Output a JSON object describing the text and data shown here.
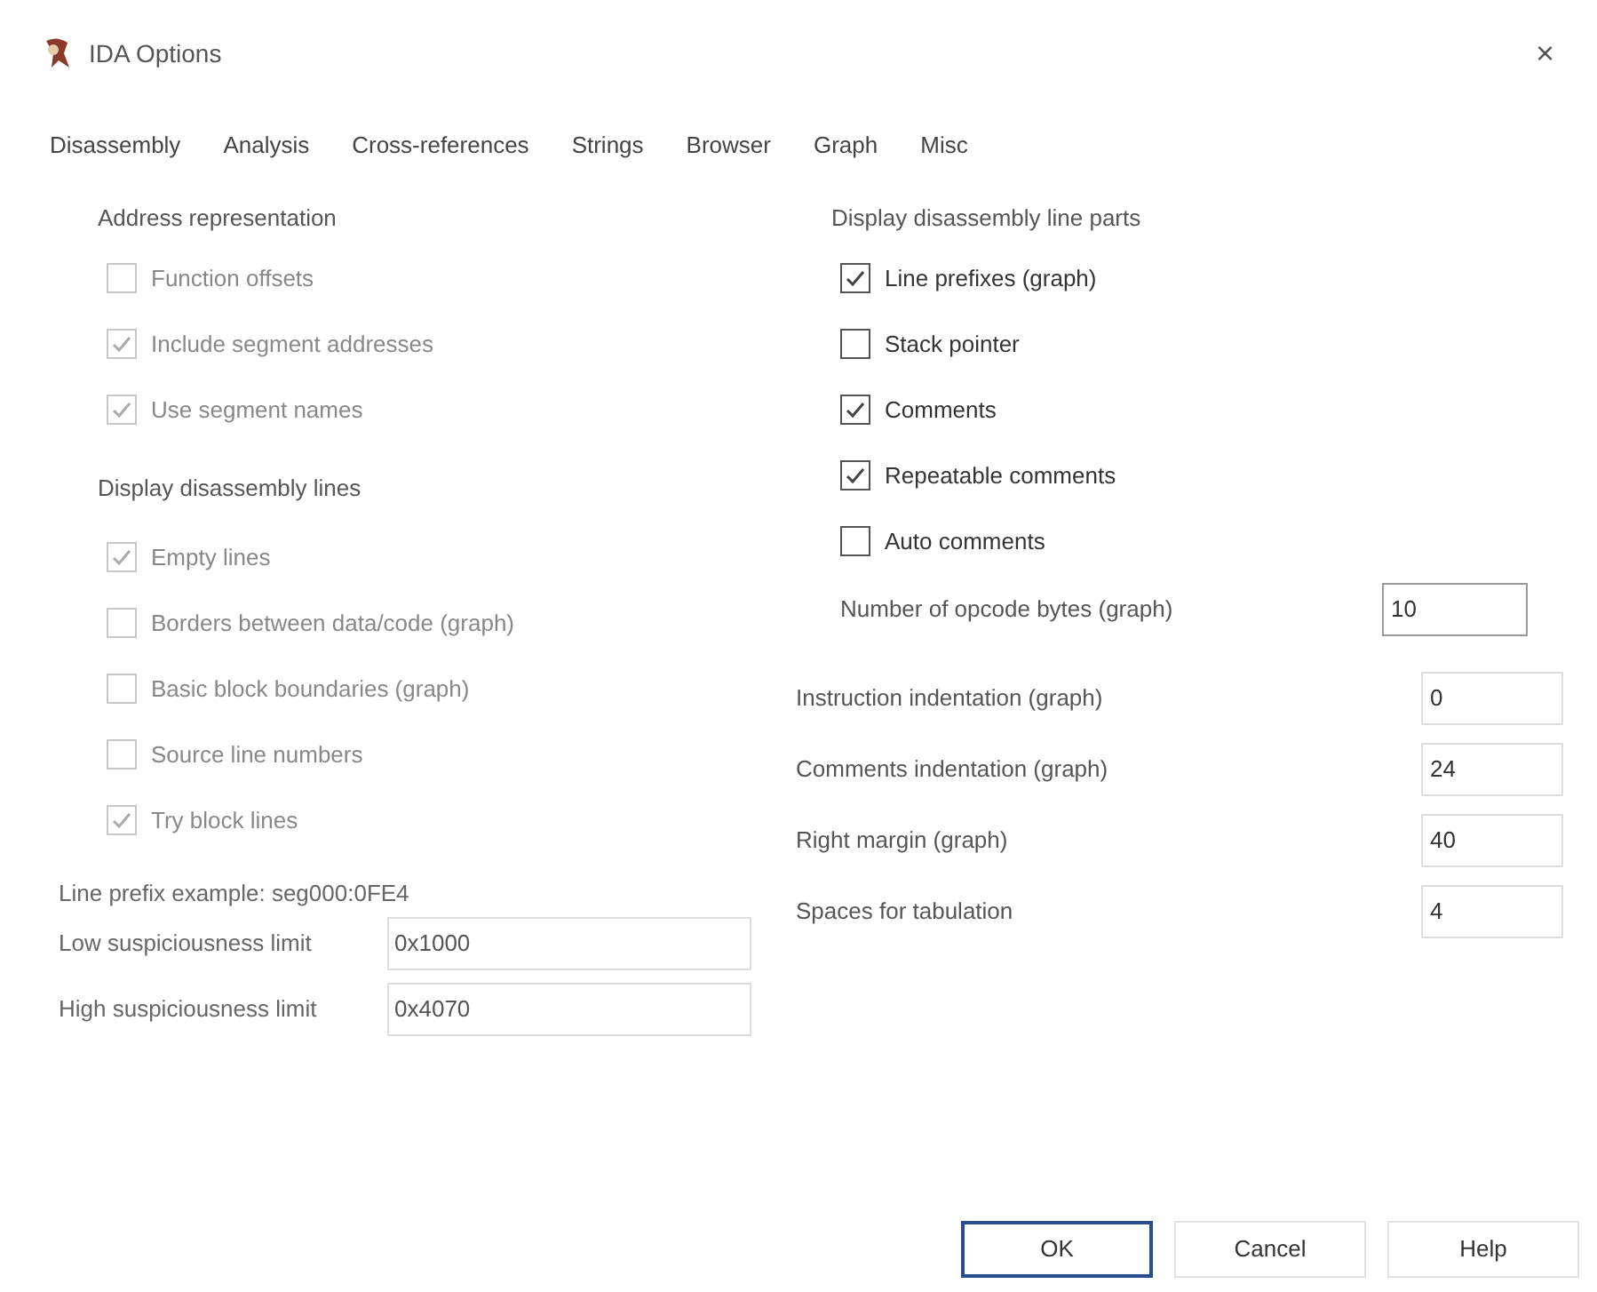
{
  "window": {
    "title": "IDA Options",
    "close": "×"
  },
  "tabs": [
    "Disassembly",
    "Analysis",
    "Cross-references",
    "Strings",
    "Browser",
    "Graph",
    "Misc"
  ],
  "left": {
    "address_group": {
      "title": "Address representation",
      "options": [
        {
          "label": "Function offsets",
          "checked": false,
          "disabled": true
        },
        {
          "label": "Include segment addresses",
          "checked": true,
          "disabled": true
        },
        {
          "label": "Use segment names",
          "checked": true,
          "disabled": true
        }
      ]
    },
    "lines_group": {
      "title": "Display disassembly lines",
      "options": [
        {
          "label": "Empty lines",
          "checked": true,
          "disabled": true
        },
        {
          "label": "Borders between data/code (graph)",
          "checked": false,
          "disabled": true
        },
        {
          "label": "Basic block boundaries (graph)",
          "checked": false,
          "disabled": true
        },
        {
          "label": "Source line numbers",
          "checked": false,
          "disabled": true
        },
        {
          "label": "Try block lines",
          "checked": true,
          "disabled": true
        }
      ]
    },
    "line_prefix_example": "Line prefix example: seg000:0FE4",
    "fields": [
      {
        "label": "Low suspiciousness limit",
        "value": "0x1000"
      },
      {
        "label": "High suspiciousness limit",
        "value": "0x4070"
      }
    ]
  },
  "right": {
    "parts_group": {
      "title": "Display disassembly line parts",
      "options": [
        {
          "label": "Line prefixes (graph)",
          "checked": true,
          "disabled": false
        },
        {
          "label": "Stack pointer",
          "checked": false,
          "disabled": false
        },
        {
          "label": "Comments",
          "checked": true,
          "disabled": false
        },
        {
          "label": "Repeatable comments",
          "checked": true,
          "disabled": false
        },
        {
          "label": "Auto comments",
          "checked": false,
          "disabled": false
        }
      ]
    },
    "opcode_bytes": {
      "label": "Number of opcode bytes (graph)",
      "value": "10"
    },
    "fields": [
      {
        "label": "Instruction indentation (graph)",
        "value": "0"
      },
      {
        "label": "Comments indentation (graph)",
        "value": "24"
      },
      {
        "label": "Right margin (graph)",
        "value": "40"
      },
      {
        "label": "Spaces for tabulation",
        "value": "4"
      }
    ]
  },
  "buttons": [
    {
      "label": "OK",
      "default": true
    },
    {
      "label": "Cancel",
      "default": false
    },
    {
      "label": "Help",
      "default": false
    }
  ]
}
